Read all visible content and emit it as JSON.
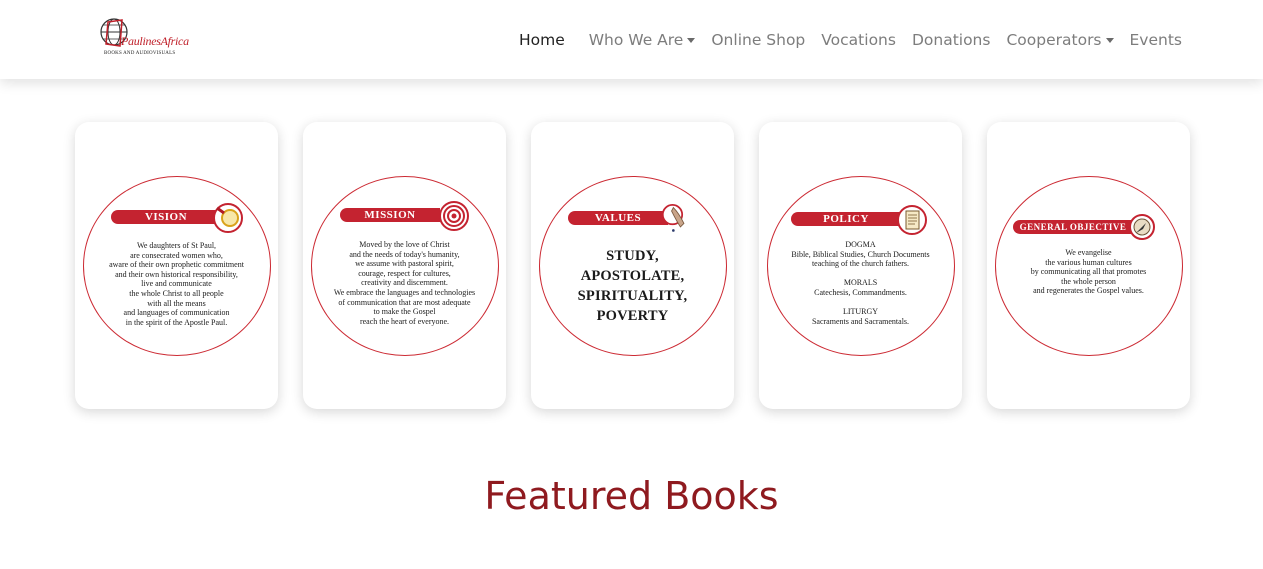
{
  "logo": {
    "name": "PaulinesAfrica",
    "subtitle": "BOOKS AND AUDIOVISUALS"
  },
  "nav": {
    "items": [
      {
        "label": "Home"
      },
      {
        "label": "Who We Are"
      },
      {
        "label": "Online Shop"
      },
      {
        "label": "Vocations"
      },
      {
        "label": "Donations"
      },
      {
        "label": "Cooperators"
      },
      {
        "label": "Events"
      }
    ]
  },
  "cards": [
    {
      "title": "VISION",
      "icon": "magnifier-icon",
      "lines": [
        "We daughters of St Paul,",
        "are consecrated women who,",
        "aware of their own prophetic commitment",
        "and their own historical responsibility,",
        "live and communicate",
        "the whole Christ to all people",
        "with all the means",
        "and languages of communication",
        "in the spirit of the Apostle Paul."
      ]
    },
    {
      "title": "MISSION",
      "icon": "target-icon",
      "lines": [
        "Moved by the love of Christ",
        "and the needs of today's humanity,",
        "we assume with pastoral spirit,",
        "courage, respect for cultures,",
        "creativity and discernment.",
        "We embrace the languages and technologies",
        "of communication that are most adequate",
        "to make the Gospel",
        "reach the heart of everyone."
      ]
    },
    {
      "title": "VALUES",
      "icon": "praying-hands-icon",
      "lines": [
        "STUDY,",
        "APOSTOLATE,",
        "SPIRITUALITY,",
        "POVERTY"
      ]
    },
    {
      "title": "POLICY",
      "icon": "document-icon",
      "lines": [
        "DOGMA",
        "Bible, Biblical Studies, Church Documents",
        "teaching of the church fathers.",
        "",
        "MORALS",
        "Catechesis, Commandments.",
        "",
        "LITURGY",
        "Sacraments and Sacramentals."
      ]
    },
    {
      "title": "GENERAL OBJECTIVE",
      "icon": "compass-icon",
      "lines": [
        "We evangelise",
        "the various human cultures",
        "by communicating all that promotes",
        "the whole person",
        "and regenerates the Gospel values."
      ]
    }
  ],
  "featured": {
    "heading": "Featured Books"
  },
  "colors": {
    "brand_red": "#c42330",
    "heading_red": "#8f1a1f",
    "nav_gray": "#7d7d7d",
    "nav_active": "#222222"
  }
}
